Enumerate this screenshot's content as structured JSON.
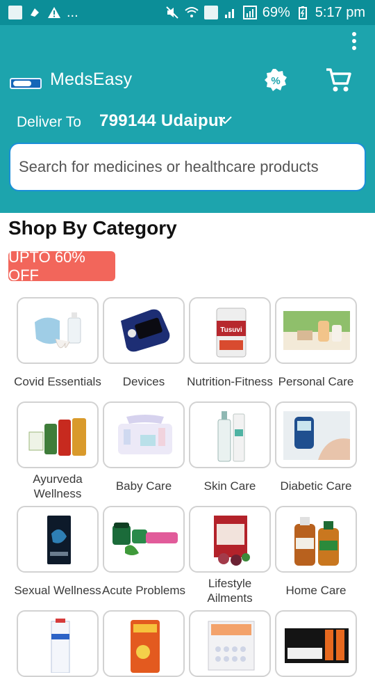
{
  "status_bar": {
    "left_dots": "...",
    "battery": "69%",
    "time": "5:17 pm"
  },
  "app": {
    "title": "MedsEasy"
  },
  "delivery": {
    "label": "Deliver To",
    "pincode_city": "799144  Udaipur"
  },
  "search": {
    "placeholder": "Search for medicines or healthcare products"
  },
  "main": {
    "section_title": "Shop By Category",
    "promo_badge": "UPTO 60% OFF"
  },
  "categories": [
    {
      "label": "Covid Essentials",
      "icon": "mask-sanitizer-icon"
    },
    {
      "label": "Devices",
      "icon": "oximeter-icon"
    },
    {
      "label": "Nutrition-Fitness",
      "icon": "supplement-tin-icon"
    },
    {
      "label": "Personal Care",
      "icon": "soap-bottle-icon"
    },
    {
      "label": "Ayurveda Wellness",
      "icon": "ayurveda-bottles-icon"
    },
    {
      "label": "Baby Care",
      "icon": "baby-products-icon"
    },
    {
      "label": "Skin Care",
      "icon": "skin-serum-icon"
    },
    {
      "label": "Diabetic Care",
      "icon": "glucometer-icon"
    },
    {
      "label": "Sexual Wellness",
      "icon": "wellness-pack-icon"
    },
    {
      "label": "Acute Problems",
      "icon": "balm-tube-icon"
    },
    {
      "label": "Lifestyle Ailments",
      "icon": "health-book-icon"
    },
    {
      "label": "Home Care",
      "icon": "disinfectant-icon"
    },
    {
      "label": "",
      "icon": "medicine-box-icon"
    },
    {
      "label": "",
      "icon": "glucon-d-pack-icon"
    },
    {
      "label": "",
      "icon": "tablet-strip-icon"
    },
    {
      "label": "",
      "icon": "pain-relief-gel-icon"
    }
  ],
  "colors": {
    "appbar": "#1da4ad",
    "statusbar": "#0c8e98",
    "promo": "#f2665b",
    "search_border": "#1a8fd8"
  }
}
